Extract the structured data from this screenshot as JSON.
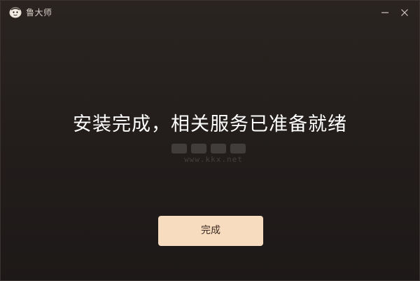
{
  "window": {
    "title": "鲁大师"
  },
  "main": {
    "headline": "安装完成，相关服务已准备就绪",
    "done_label": "完成"
  },
  "watermark": {
    "text": "www.kkx.net"
  },
  "icons": {
    "logo": "ludashi-monkey-logo-icon",
    "minimize": "minimize-icon",
    "close": "close-icon"
  },
  "colors": {
    "background": "#231e1c",
    "button": "#f8dcc0",
    "button_text": "#3c2a20",
    "headline": "#ffffff"
  }
}
